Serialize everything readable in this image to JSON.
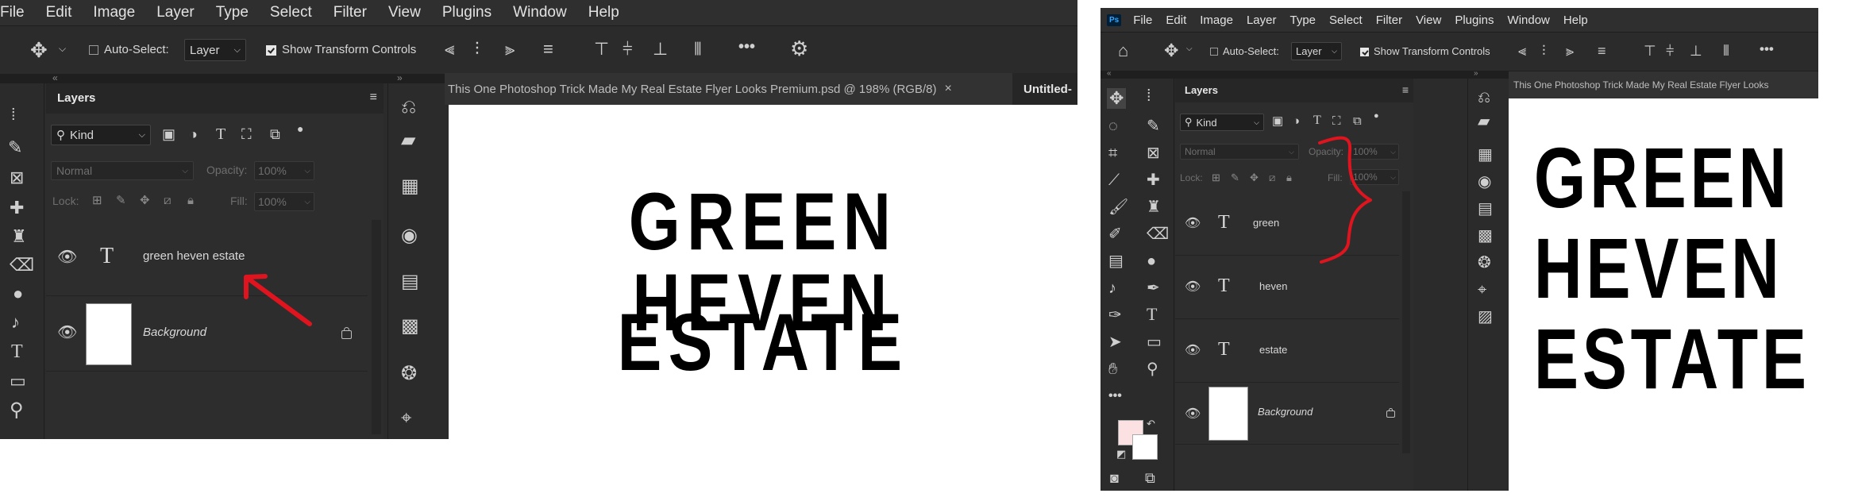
{
  "left": {
    "menu": [
      "File",
      "Edit",
      "Image",
      "Layer",
      "Type",
      "Select",
      "Filter",
      "View",
      "Plugins",
      "Window",
      "Help"
    ],
    "options": {
      "auto_select_label": "Auto-Select:",
      "auto_select_value": "Layer",
      "show_transform_label": "Show Transform Controls",
      "more": "•••"
    },
    "layers_tab": "Layers",
    "filter_kind": "Kind",
    "blend_mode": "Normal",
    "opacity_label": "Opacity:",
    "opacity_value": "100%",
    "lock_label": "Lock:",
    "fill_label": "Fill:",
    "fill_value": "100%",
    "layers": [
      {
        "name": "green heven estate",
        "type": "text"
      },
      {
        "name": "Background",
        "type": "background"
      }
    ],
    "doc_tab": "This One Photoshop Trick Made My Real Estate Flyer Looks Premium.psd @ 198% (RGB/8)",
    "doc_tab_close": "×",
    "doc_tab2": "Untitled-",
    "canvas_lines": [
      "GREEN HEVEN",
      "ESTATE"
    ]
  },
  "right": {
    "app_badge": "Ps",
    "menu": [
      "File",
      "Edit",
      "Image",
      "Layer",
      "Type",
      "Select",
      "Filter",
      "View",
      "Plugins",
      "Window",
      "Help"
    ],
    "options": {
      "auto_select_label": "Auto-Select:",
      "auto_select_value": "Layer",
      "show_transform_label": "Show Transform Controls",
      "more": "•••"
    },
    "layers_tab": "Layers",
    "filter_kind": "Kind",
    "blend_mode": "Normal",
    "opacity_label": "Opacity:",
    "opacity_value": "100%",
    "lock_label": "Lock:",
    "fill_label": "Fill:",
    "fill_value": "100%",
    "layers": [
      {
        "name": "green",
        "type": "text"
      },
      {
        "name": "heven",
        "type": "text"
      },
      {
        "name": "estate",
        "type": "text"
      },
      {
        "name": "Background",
        "type": "background"
      }
    ],
    "doc_tab": "This One Photoshop Trick Made My Real Estate Flyer Looks",
    "canvas_lines": [
      "GREEN",
      "HEVEN",
      "ESTATE"
    ]
  },
  "colors": {
    "annotation": "#e0141e",
    "ui_bg": "#2b2b2b",
    "foreground_swatch": "#fbe1e1"
  },
  "icons": [
    "move-icon",
    "eye-icon",
    "text-layer-icon",
    "lock-icon",
    "gear-icon",
    "home-icon",
    "brush-icon",
    "zoom-icon"
  ]
}
